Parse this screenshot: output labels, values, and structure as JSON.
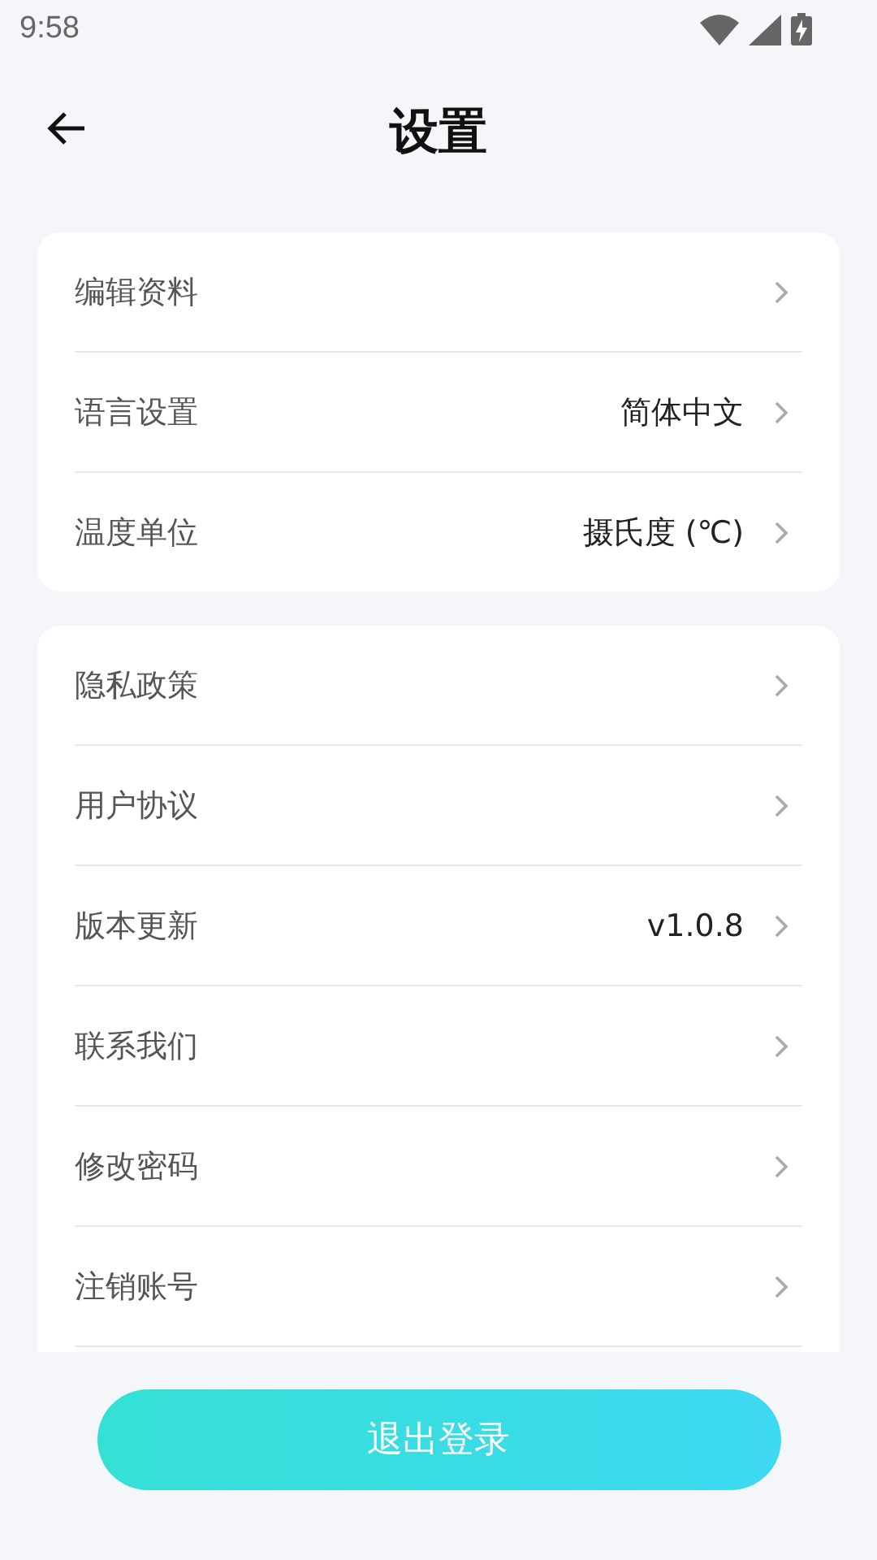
{
  "status_bar": {
    "time": "9:58"
  },
  "header": {
    "title": "设置"
  },
  "groups": [
    {
      "items": [
        {
          "label": "编辑资料"
        },
        {
          "label": "语言设置",
          "value": "简体中文"
        },
        {
          "label": "温度单位",
          "value": "摄氏度 (℃)"
        }
      ]
    },
    {
      "items": [
        {
          "label": "隐私政策"
        },
        {
          "label": "用户协议"
        },
        {
          "label": "版本更新",
          "value": "v1.0.8"
        },
        {
          "label": "联系我们"
        },
        {
          "label": "修改密码"
        },
        {
          "label": "注销账号"
        }
      ]
    }
  ],
  "logout_button": "退出登录"
}
